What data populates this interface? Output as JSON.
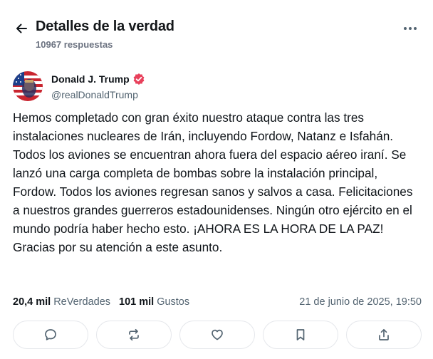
{
  "header": {
    "title": "Detalles de la verdad",
    "subtitle": "10967 respuestas",
    "back_icon": "arrow-left-icon",
    "more_icon": "more-horizontal-icon"
  },
  "author": {
    "name": "Donald J. Trump",
    "handle": "@realDonaldTrump",
    "verified_color": "#e8405b"
  },
  "post": {
    "text": "Hemos completado con gran éxito nuestro ataque contra las tres instalaciones nucleares de Irán, incluyendo Fordow, Natanz e Isfahán. Todos los aviones se encuentran ahora fuera del espacio aéreo iraní. Se lanzó una carga completa de bombas sobre la instalación principal, Fordow. Todos los aviones regresan sanos y salvos a casa. Felicitaciones a nuestros grandes guerreros estadounidenses. Ningún otro ejército en el mundo podría haber hecho esto. ¡AHORA ES LA HORA DE LA PAZ! Gracias por su atención a este asunto."
  },
  "stats": {
    "reverdades_count": "20,4 mil",
    "reverdades_label": "ReVerdades",
    "likes_count": "101 mil",
    "likes_label": "Gustos",
    "date": "21 de junio de 2025, 19:50"
  },
  "actions": [
    {
      "icon": "reply-icon"
    },
    {
      "icon": "repost-icon"
    },
    {
      "icon": "heart-icon"
    },
    {
      "icon": "bookmark-icon"
    },
    {
      "icon": "share-icon"
    }
  ]
}
